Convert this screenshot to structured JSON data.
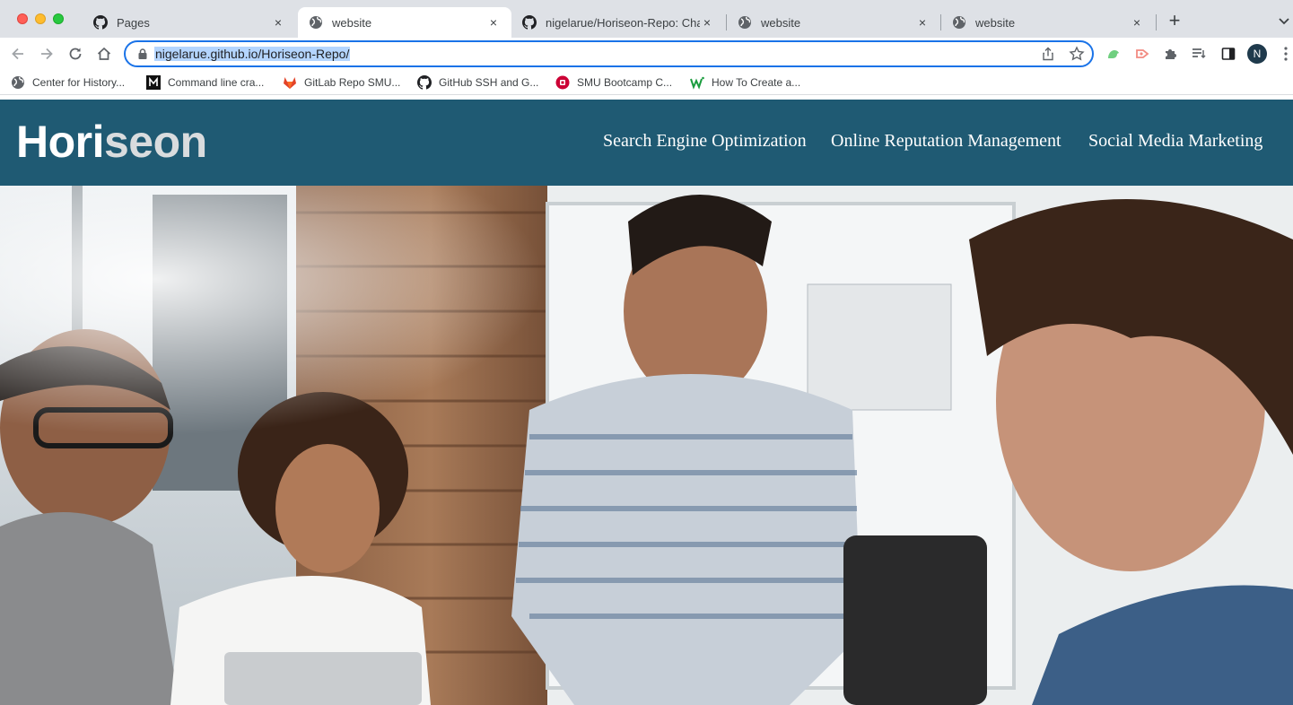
{
  "browser": {
    "tabs": [
      {
        "title": "Pages",
        "icon": "github-icon",
        "active": false
      },
      {
        "title": "website",
        "icon": "globe-icon",
        "active": true
      },
      {
        "title": "nigelarue/Horiseon-Repo: Chal",
        "icon": "github-icon",
        "active": false
      },
      {
        "title": "website",
        "icon": "globe-icon",
        "active": false
      },
      {
        "title": "website",
        "icon": "globe-icon",
        "active": false
      }
    ],
    "new_tab_label": "+",
    "close_label": "×",
    "address": "nigelarue.github.io/Horiseon-Repo/",
    "profile_initial": "N",
    "bookmarks": [
      {
        "label": "Center for History...",
        "icon": "globe-icon"
      },
      {
        "label": "Command line cra...",
        "icon": "m-logo-icon"
      },
      {
        "label": "GitLab Repo SMU...",
        "icon": "gitlab-icon"
      },
      {
        "label": "GitHub SSH and G...",
        "icon": "github-icon"
      },
      {
        "label": "SMU Bootcamp C...",
        "icon": "smu-icon"
      },
      {
        "label": "How To Create a...",
        "icon": "w-icon"
      }
    ]
  },
  "site": {
    "logo_main": "Hori",
    "logo_accent": "seon",
    "nav": [
      {
        "label": "Search Engine Optimization"
      },
      {
        "label": "Online Reputation Management"
      },
      {
        "label": "Social Media Marketing"
      }
    ],
    "hero_description": "team-meeting-photo"
  },
  "colors": {
    "header_bg": "#1f5a73",
    "accent_blue": "#1a73e8",
    "tab_strip": "#dee1e6"
  }
}
